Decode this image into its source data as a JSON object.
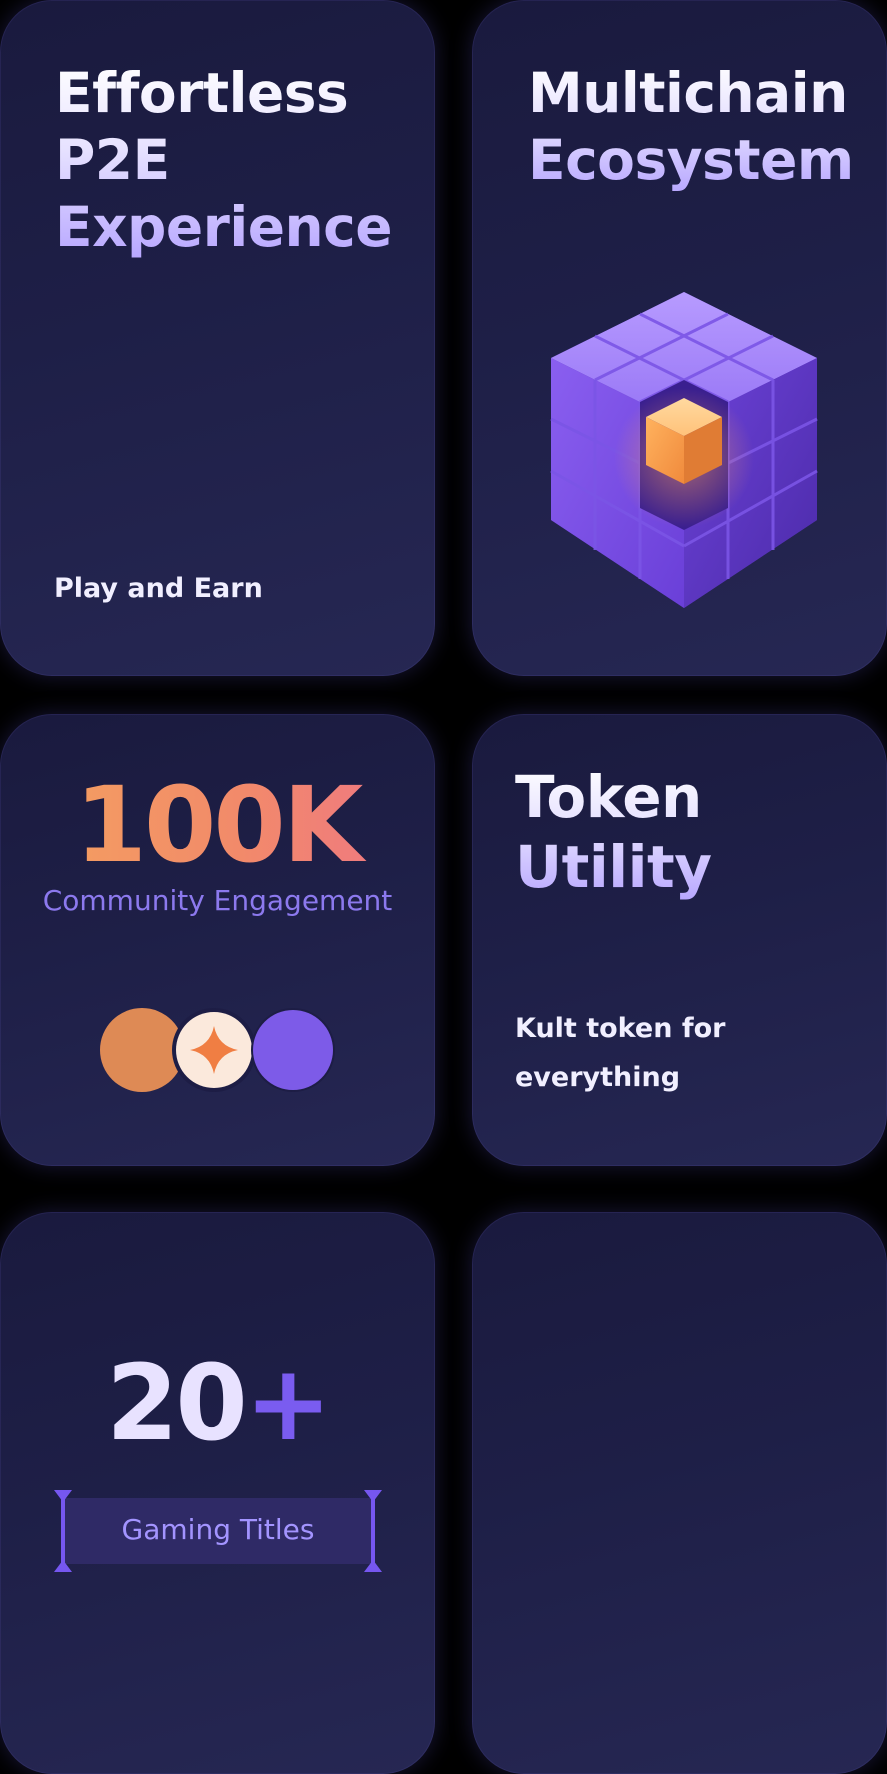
{
  "cards": {
    "p2e": {
      "title_line1": "Effortless",
      "title_line2": "P2E",
      "title_line3": "Experience",
      "subtitle": "Play and Earn"
    },
    "multichain": {
      "title_line1": "Multichain",
      "title_line2": "Ecosystem",
      "icon": "purple-cube-icon"
    },
    "community": {
      "stat": "100K",
      "label": "Community Engagement",
      "icon": "community-circles-icon"
    },
    "token": {
      "title": "Token Utility",
      "subtitle_line1": "Kult token for",
      "subtitle_line2": "everything"
    },
    "gaming": {
      "stat_number": "20",
      "stat_suffix": "+",
      "label": "Gaming Titles"
    },
    "empty": {}
  },
  "colors": {
    "background": "#000000",
    "card": "#1e1f47",
    "accent_purple": "#7657f0",
    "accent_orange": "#f4a35e",
    "label_purple": "#8c79ee"
  }
}
